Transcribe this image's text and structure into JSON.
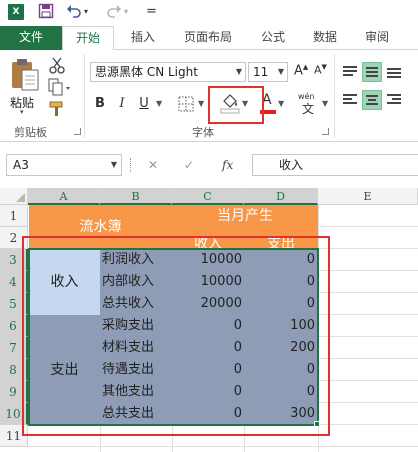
{
  "app": {
    "logo": "X",
    "quick_access": {
      "undo_arrow": "▾",
      "redo_arrow": "▾",
      "customize": "="
    }
  },
  "tabs": [
    {
      "label": "文件"
    },
    {
      "label": "开始"
    },
    {
      "label": "插入"
    },
    {
      "label": "页面布局"
    },
    {
      "label": "公式"
    },
    {
      "label": "数据"
    },
    {
      "label": "审阅"
    }
  ],
  "ribbon": {
    "clipboard": {
      "paste_label": "粘贴",
      "group_label": "剪贴板"
    },
    "font": {
      "family": "思源黑体 CN Light",
      "size": "11",
      "bold": "B",
      "italic": "I",
      "underline": "U",
      "font_color": "A",
      "phonetic": "wén",
      "group_label": "字体"
    }
  },
  "formula_bar": {
    "name_box": "A3",
    "cancel": "✕",
    "enter": "✓",
    "fx": "fx",
    "formula": "收入"
  },
  "sheet": {
    "columns": [
      "A",
      "B",
      "C",
      "D",
      "E"
    ],
    "rows": [
      "1",
      "2",
      "3",
      "4",
      "5",
      "6",
      "7",
      "8",
      "9",
      "10",
      "11"
    ],
    "header": {
      "title": "流水簿",
      "month_label": "当月产生",
      "income_col": "收入",
      "expense_col": "支出"
    },
    "groups": {
      "income": "收入",
      "expense": "支出"
    },
    "records": [
      {
        "item": "利润收入",
        "income": "10000",
        "expense": "0"
      },
      {
        "item": "内部收入",
        "income": "10000",
        "expense": "0"
      },
      {
        "item": "总共收入",
        "income": "20000",
        "expense": "0"
      },
      {
        "item": "采购支出",
        "income": "0",
        "expense": "100"
      },
      {
        "item": "材料支出",
        "income": "0",
        "expense": "200"
      },
      {
        "item": "待遇支出",
        "income": "0",
        "expense": "0"
      },
      {
        "item": "其他支出",
        "income": "0",
        "expense": "0"
      },
      {
        "item": "总共支出",
        "income": "0",
        "expense": "300"
      }
    ]
  },
  "colors": {
    "excel_green": "#217346",
    "header_orange": "#f79646",
    "fill_blue": "#8e9cb6",
    "fill_light_blue": "#c5d8ef",
    "highlight_red": "#e03030"
  }
}
